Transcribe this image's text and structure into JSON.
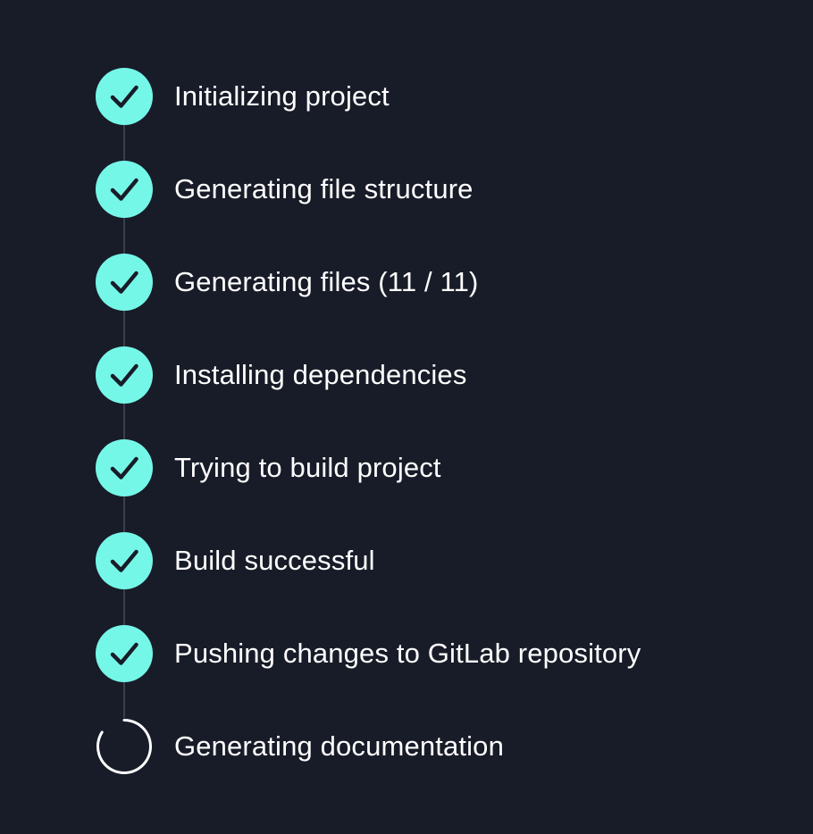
{
  "colors": {
    "background": "#181c28",
    "success_accent": "#75f7e8",
    "check_mark": "#181c28",
    "text": "#ffffff",
    "connector": "#3a3f4b",
    "spinner": "#ffffff"
  },
  "steps": [
    {
      "label": "Initializing project",
      "status": "complete",
      "icon": "check-icon"
    },
    {
      "label": "Generating file structure",
      "status": "complete",
      "icon": "check-icon"
    },
    {
      "label": "Generating files (11 / 11)",
      "status": "complete",
      "icon": "check-icon"
    },
    {
      "label": "Installing dependencies",
      "status": "complete",
      "icon": "check-icon"
    },
    {
      "label": "Trying to build project",
      "status": "complete",
      "icon": "check-icon"
    },
    {
      "label": "Build successful",
      "status": "complete",
      "icon": "check-icon"
    },
    {
      "label": "Pushing changes to GitLab repository",
      "status": "complete",
      "icon": "check-icon"
    },
    {
      "label": "Generating documentation",
      "status": "in-progress",
      "icon": "spinner-icon"
    }
  ]
}
